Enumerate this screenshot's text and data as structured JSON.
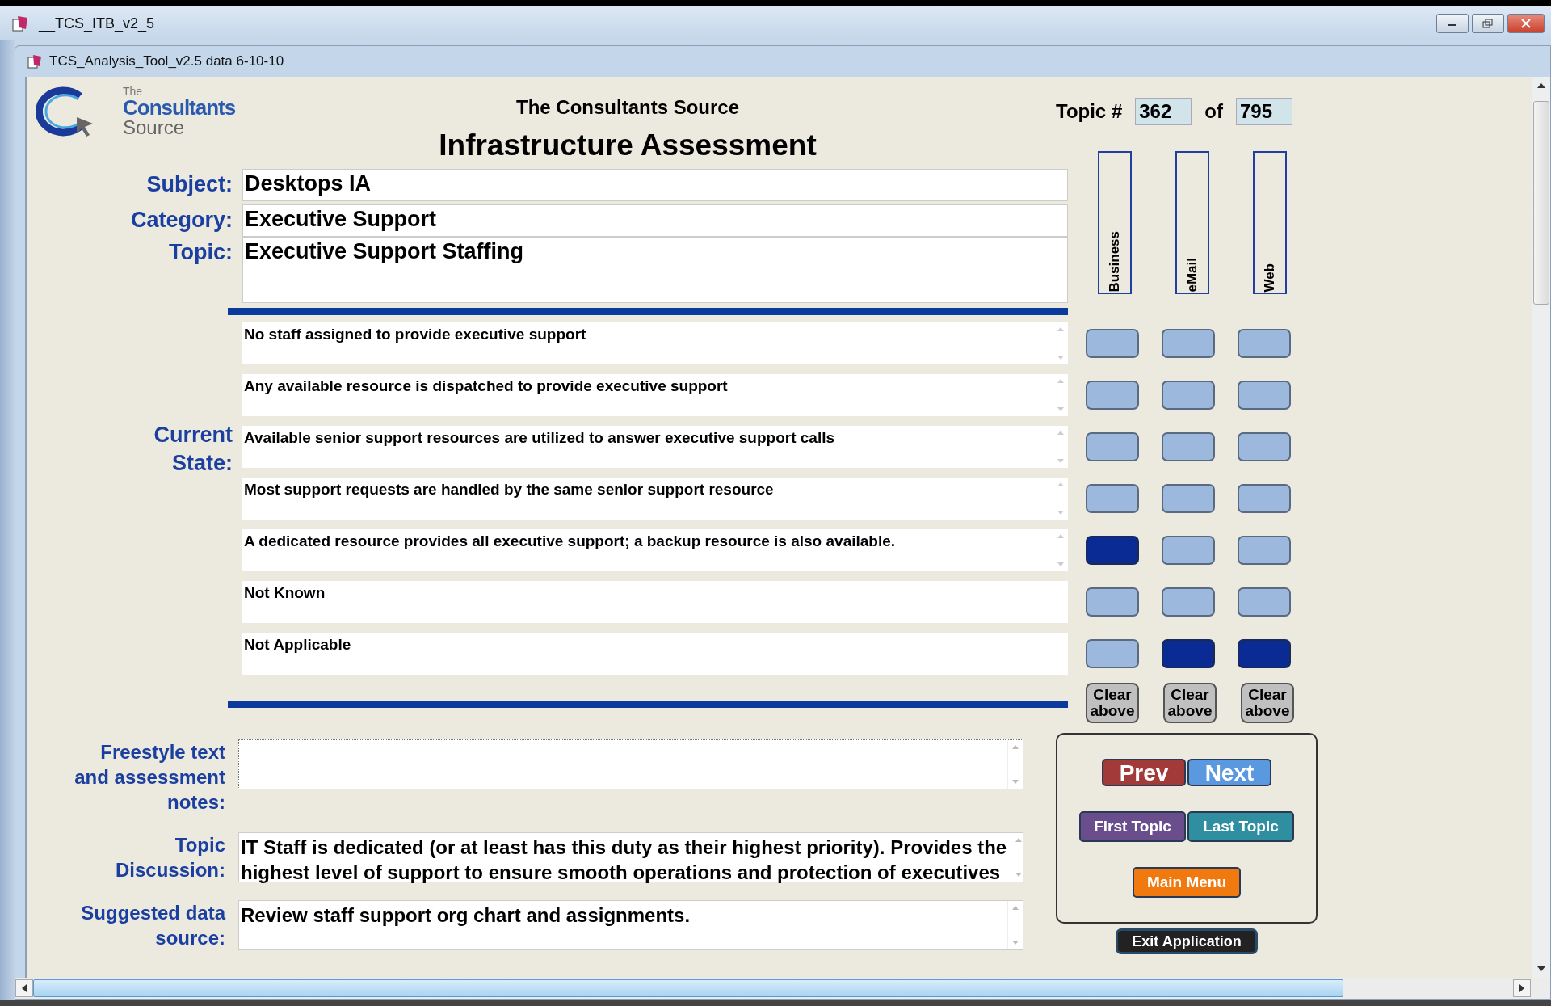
{
  "app_window": {
    "title": "__TCS_ITB_v2_5"
  },
  "form_window": {
    "title": "TCS_Analysis_Tool_v2.5 data 6-10-10"
  },
  "logo": {
    "small": "The",
    "main": "Consultants",
    "sub": "Source"
  },
  "header": {
    "org": "The Consultants Source",
    "title": "Infrastructure Assessment"
  },
  "topic_counter": {
    "label": "Topic #",
    "current": "362",
    "of_label": "of",
    "total": "795"
  },
  "fields": [
    {
      "label": "Subject:",
      "value": "Desktops IA"
    },
    {
      "label": "Category:",
      "value": "Executive Support"
    },
    {
      "label": "Topic:",
      "value": "Executive Support Staffing"
    }
  ],
  "columns": [
    "Business",
    "eMail",
    "Web"
  ],
  "current_state": {
    "label": "Current State:",
    "options": [
      {
        "text": "No staff assigned to provide executive support",
        "scrollable": true,
        "choices": [
          {
            "selected": false
          },
          {
            "selected": false
          },
          {
            "selected": false
          }
        ]
      },
      {
        "text": "Any available resource is dispatched to provide executive support",
        "scrollable": true,
        "choices": [
          {
            "selected": false
          },
          {
            "selected": false
          },
          {
            "selected": false
          }
        ]
      },
      {
        "text": "Available senior support resources are utilized to answer executive support calls",
        "scrollable": true,
        "choices": [
          {
            "selected": false
          },
          {
            "selected": false
          },
          {
            "selected": false
          }
        ]
      },
      {
        "text": "Most support requests are handled by the same senior support resource",
        "scrollable": true,
        "choices": [
          {
            "selected": false
          },
          {
            "selected": false
          },
          {
            "selected": false
          }
        ]
      },
      {
        "text": "A dedicated resource provides all executive support; a backup resource is also available.",
        "scrollable": true,
        "choices": [
          {
            "selected": true
          },
          {
            "selected": false
          },
          {
            "selected": false
          }
        ]
      },
      {
        "text": "Not Known",
        "scrollable": false,
        "choices": [
          {
            "selected": false
          },
          {
            "selected": false
          },
          {
            "selected": false
          }
        ]
      },
      {
        "text": "Not Applicable",
        "scrollable": false,
        "choices": [
          {
            "selected": false
          },
          {
            "selected": true
          },
          {
            "selected": true
          }
        ]
      }
    ]
  },
  "clear_buttons": [
    "Clear above",
    "Clear above",
    "Clear above"
  ],
  "notes": [
    {
      "label": "Freestyle text and assessment notes:"
    },
    {
      "label": "Topic Discussion:",
      "value": "IT Staff is dedicated (or at least has this duty as their highest priority).  Provides the highest level of support to ensure smooth operations and protection of executives"
    },
    {
      "label": "Suggested data source:",
      "value": "Review staff support org chart and assignments."
    }
  ],
  "nav_buttons": [
    {
      "label": "Prev",
      "kind": "prev"
    },
    {
      "label": "Next",
      "kind": "next"
    },
    {
      "label": "First Topic",
      "kind": "first"
    },
    {
      "label": "Last Topic",
      "kind": "last"
    },
    {
      "label": "Main Menu",
      "kind": "menu"
    }
  ],
  "exit_button": "Exit Application"
}
